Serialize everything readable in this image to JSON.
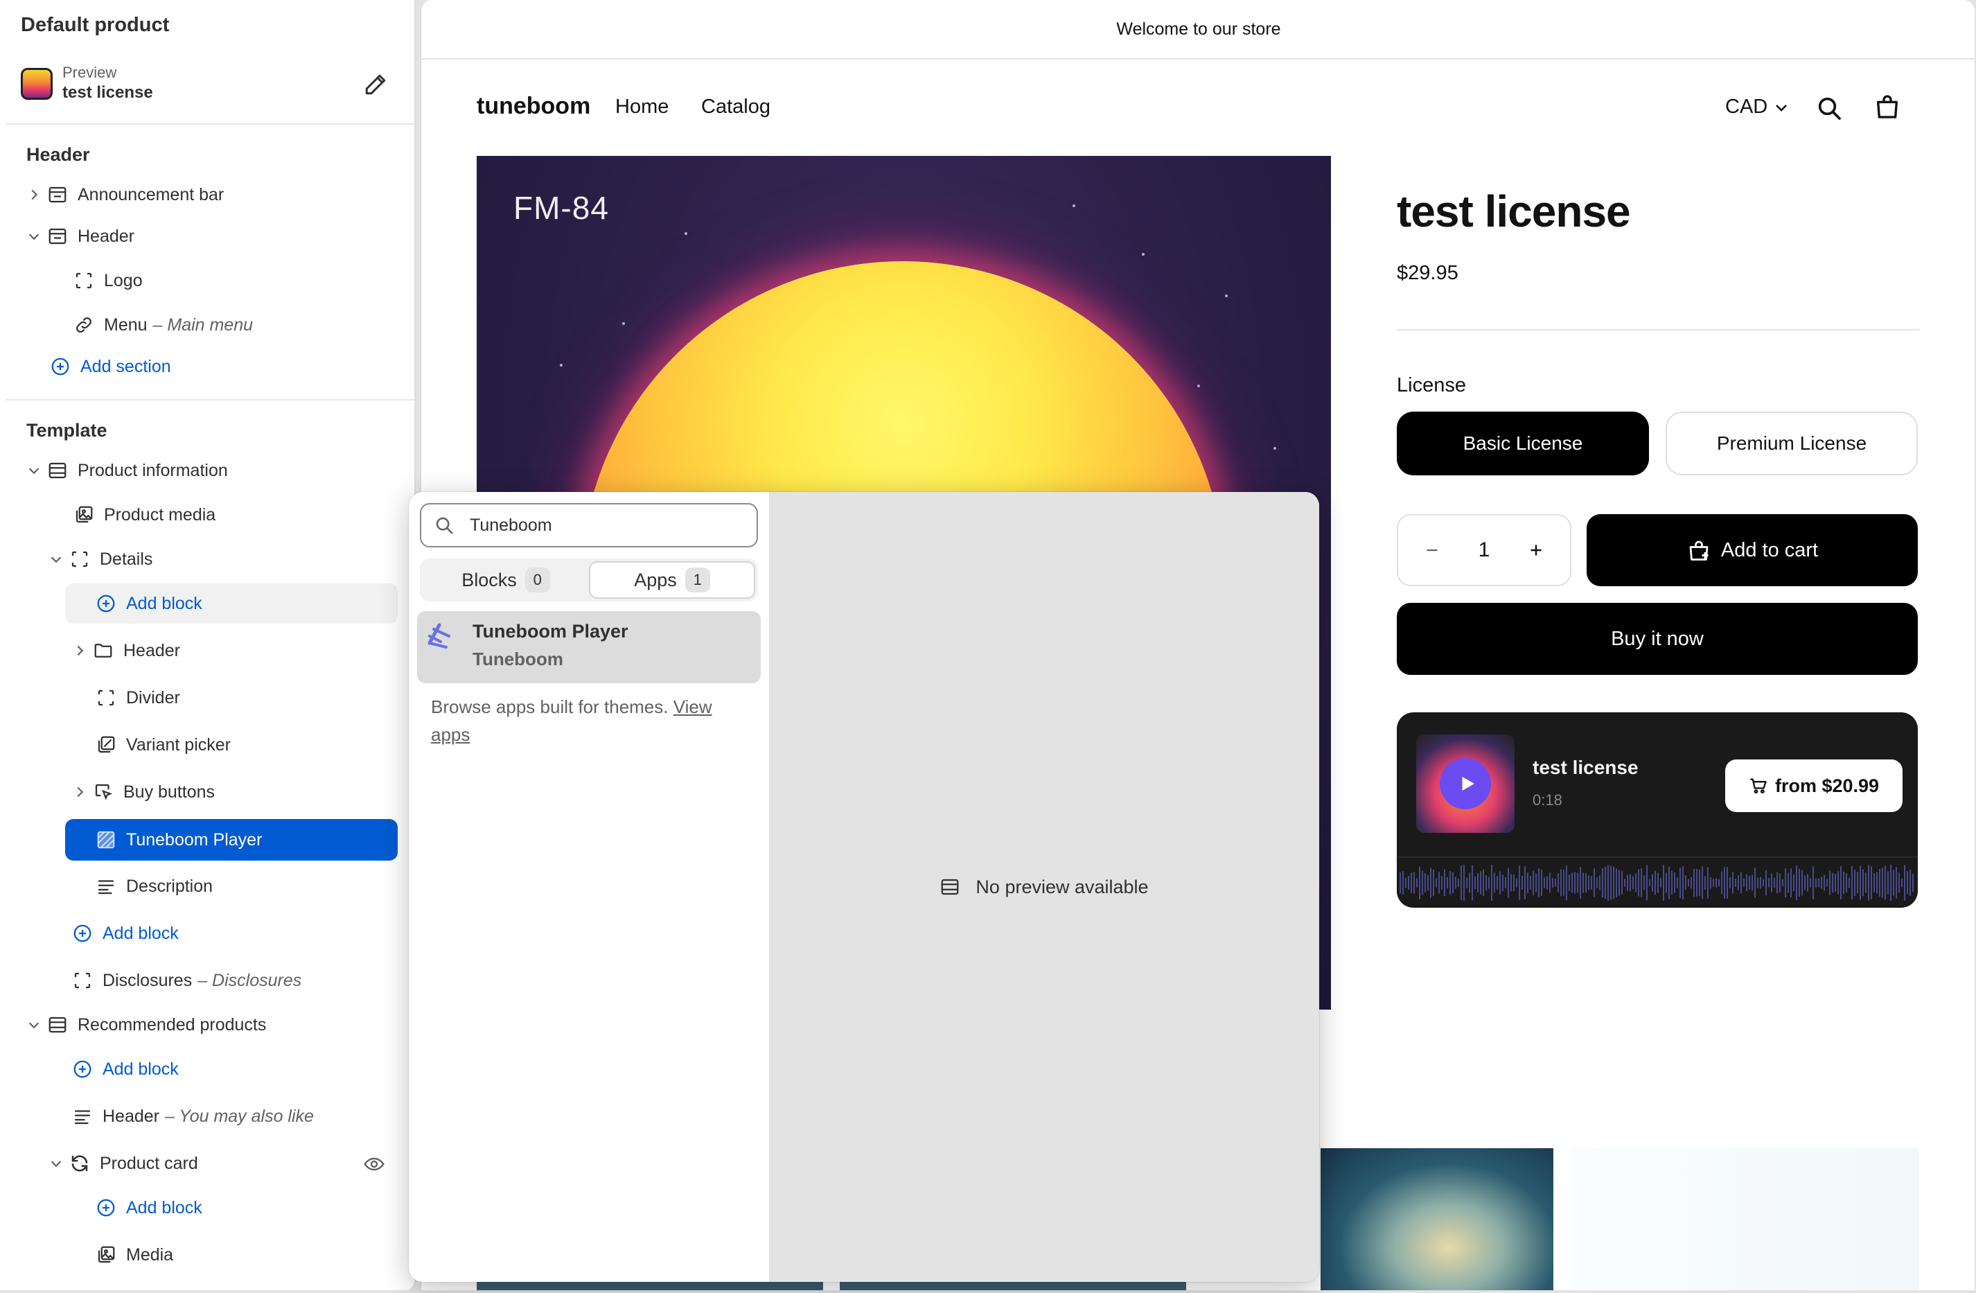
{
  "sidebar": {
    "title": "Default product",
    "preview_label": "Preview",
    "preview_value": "test license",
    "header_group": "Header",
    "template_group": "Template",
    "items": {
      "announcement_bar": "Announcement bar",
      "header": "Header",
      "logo": "Logo",
      "menu": "Menu",
      "menu_meta": "– Main menu",
      "add_section": "Add section",
      "product_information": "Product information",
      "product_media": "Product media",
      "details": "Details",
      "add_block_1": "Add block",
      "details_header": "Header",
      "divider": "Divider",
      "variant_picker": "Variant picker",
      "buy_buttons": "Buy buttons",
      "tuneboom_player": "Tuneboom Player",
      "description": "Description",
      "add_block_2": "Add block",
      "disclosures": "Disclosures",
      "disclosures_meta": "– Disclosures",
      "recommended_products": "Recommended products",
      "add_block_3": "Add block",
      "rec_header": "Header",
      "rec_header_meta": "– You may also like",
      "product_card": "Product card",
      "add_block_4": "Add block",
      "media": "Media"
    }
  },
  "store": {
    "announcement": "Welcome to our store",
    "logo": "tuneboom",
    "nav": [
      "Home",
      "Catalog"
    ],
    "currency": "CAD",
    "artwork_text": "FM-84",
    "product": {
      "title": "test license",
      "price": "$29.95",
      "license_label": "License",
      "licenses": [
        "Basic License",
        "Premium License"
      ],
      "selected_license": "Basic License",
      "quantity": "1",
      "add_to_cart": "Add to cart",
      "buy_now": "Buy it now"
    },
    "player": {
      "track_name": "test license",
      "duration": "0:18",
      "from_price": "from  $20.99"
    }
  },
  "picker": {
    "search_value": "Tuneboom",
    "tabs": [
      {
        "label": "Blocks",
        "count": "0"
      },
      {
        "label": "Apps",
        "count": "1"
      }
    ],
    "active_tab": "Apps",
    "result": {
      "name": "Tuneboom Player",
      "vendor": "Tuneboom"
    },
    "browse_text": "Browse apps built for themes.",
    "browse_link": "View apps",
    "no_preview": "No preview available"
  },
  "colors": {
    "accent_blue": "#005bd3",
    "black_button": "#000000",
    "player_bg": "#1a1a1a",
    "play_button": "#6a4cf0"
  }
}
